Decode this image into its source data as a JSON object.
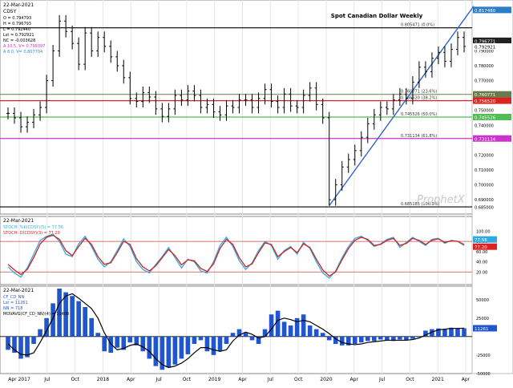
{
  "chart_data": [
    {
      "type": "bar",
      "panel": "price",
      "title": "Spot Canadian Dollar Weekly",
      "header": {
        "date": "22-Mar-2021",
        "symbol": "CDSY",
        "ohlc": [
          "O = 0.794793",
          "H = 0.796793",
          "L = 0.792440",
          "Lst = 0.792921",
          "NC = -0.003628",
          "A 10.5, V= 0.799397",
          "A 8.0, V= 0.807704"
        ]
      },
      "xlabel": "",
      "ylabel": "",
      "x_ticks": [
        "Apr 2017",
        "Jul",
        "Oct",
        "2018",
        "Apr",
        "Jul",
        "Oct",
        "2019",
        "Apr",
        "Jul",
        "Oct",
        "2020",
        "Apr",
        "Jul",
        "Oct",
        "2021",
        "Apr"
      ],
      "y_ticks": [
        "0.817480",
        "0.796771",
        "0.792921",
        "0.790000",
        "0.780000",
        "0.770000",
        "0.760771",
        "0.756520",
        "0.750000",
        "0.745526",
        "0.740000",
        "0.731134",
        "0.720000",
        "0.710000",
        "0.700000",
        "0.690000",
        "0.685000"
      ],
      "ylim": [
        0.682,
        0.822
      ],
      "price_series": [
        0.748,
        0.745,
        0.739,
        0.742,
        0.747,
        0.752,
        0.77,
        0.79,
        0.81,
        0.803,
        0.795,
        0.781,
        0.802,
        0.79,
        0.799,
        0.793,
        0.786,
        0.78,
        0.772,
        0.758,
        0.756,
        0.762,
        0.759,
        0.751,
        0.746,
        0.751,
        0.76,
        0.757,
        0.763,
        0.76,
        0.752,
        0.754,
        0.749,
        0.747,
        0.753,
        0.752,
        0.757,
        0.757,
        0.752,
        0.758,
        0.764,
        0.756,
        0.752,
        0.761,
        0.753,
        0.752,
        0.76,
        0.765,
        0.754,
        0.745,
        0.69,
        0.7,
        0.712,
        0.717,
        0.723,
        0.732,
        0.741,
        0.747,
        0.752,
        0.751,
        0.757,
        0.761,
        0.758,
        0.769,
        0.779,
        0.776,
        0.785,
        0.789,
        0.783,
        0.791,
        0.799,
        0.793
      ],
      "horizontal_levels": [
        {
          "value": 0.805471,
          "label": "0.805471 (0.0%)",
          "color": "#000000"
        },
        {
          "value": 0.760771,
          "label": "0.760771 (23.6%)",
          "color": "#7a8b5a"
        },
        {
          "value": 0.75652,
          "label": "0.756520 (38.2%)",
          "color": "#dd2222"
        },
        {
          "value": 0.745526,
          "label": "0.745526 (50.0%)",
          "color": "#55bb55"
        },
        {
          "value": 0.731134,
          "label": "0.731134 (61.8%)",
          "color": "#cc33cc"
        },
        {
          "value": 0.685185,
          "label": "0.685185 (100.0%)",
          "color": "#000000"
        }
      ],
      "trendline": {
        "from": [
          50,
          0.686
        ],
        "to": [
          71,
          0.82
        ],
        "color": "#3366cc"
      },
      "right_labels": [
        {
          "value": 0.81748,
          "text": "0.817480",
          "bg": "#2a7dc9",
          "fg": "#ffffff"
        },
        {
          "value": 0.796771,
          "text": "0.796771",
          "bg": "#222222",
          "fg": "#ffffff"
        },
        {
          "value": 0.792921,
          "text": "0.792921",
          "bg": "#ffffff",
          "fg": "#000000"
        },
        {
          "value": 0.760771,
          "text": "0.760771",
          "bg": "#6a7b4a",
          "fg": "#ffffff"
        },
        {
          "value": 0.75652,
          "text": "0.756520",
          "bg": "#dd2222",
          "fg": "#ffffff"
        },
        {
          "value": 0.745526,
          "text": "0.745526",
          "bg": "#55bb55",
          "fg": "#ffffff"
        },
        {
          "value": 0.731134,
          "text": "0.731134",
          "bg": "#cc33cc",
          "fg": "#ffffff"
        }
      ],
      "watermark": "ProphetX"
    },
    {
      "type": "line",
      "panel": "stochastic",
      "header": {
        "date": "22-Mar-2021",
        "lines": [
          "STOCH: %K(CDSY)(5) = 77.56",
          "STOCH: D(CDSY)(3) = 77.20"
        ]
      },
      "ylim": [
        0,
        110
      ],
      "levels": [
        {
          "value": 80,
          "color": "#cc4444"
        },
        {
          "value": 20,
          "color": "#cc4444"
        }
      ],
      "y_ticks": [
        "100.00",
        "80.00",
        "60.00",
        "40.00",
        "20.00"
      ],
      "series": [
        {
          "name": "STOCH: %K(CDSY)(5)",
          "color": "#33aadd",
          "values": [
            30,
            18,
            10,
            28,
            55,
            82,
            90,
            94,
            80,
            55,
            50,
            75,
            90,
            70,
            45,
            30,
            40,
            62,
            85,
            70,
            40,
            25,
            18,
            35,
            50,
            68,
            48,
            28,
            45,
            40,
            22,
            18,
            40,
            72,
            88,
            70,
            42,
            25,
            38,
            62,
            80,
            72,
            45,
            62,
            70,
            55,
            78,
            66,
            40,
            18,
            8,
            22,
            48,
            70,
            86,
            90,
            82,
            70,
            75,
            84,
            88,
            68,
            78,
            88,
            80,
            72,
            84,
            86,
            76,
            82,
            80,
            72
          ]
        },
        {
          "name": "STOCH: D(CDSY)(3)",
          "color": "#cc2222",
          "values": [
            35,
            24,
            15,
            25,
            48,
            75,
            88,
            92,
            84,
            62,
            52,
            70,
            86,
            74,
            50,
            35,
            38,
            58,
            80,
            74,
            46,
            30,
            22,
            32,
            48,
            64,
            52,
            34,
            44,
            42,
            27,
            21,
            36,
            66,
            84,
            74,
            48,
            30,
            36,
            58,
            77,
            74,
            50,
            60,
            68,
            58,
            75,
            68,
            45,
            24,
            12,
            20,
            44,
            66,
            82,
            88,
            84,
            72,
            74,
            82,
            86,
            72,
            76,
            86,
            82,
            74,
            82,
            85,
            78,
            81,
            80,
            74
          ]
        }
      ],
      "right_labels": [
        {
          "text": "77.56",
          "bg": "#33aadd",
          "fg": "#ffffff"
        },
        {
          "text": "77.20",
          "bg": "#dd2222",
          "fg": "#ffffff"
        }
      ]
    },
    {
      "type": "bar",
      "panel": "cot",
      "header": {
        "date": "22-Mar-2021",
        "lines": [
          "CF_CD_NN",
          "Lst = 11261",
          "NN = 718",
          "MOVAVG(CF_CD_NN)(4) = 11408"
        ]
      },
      "ylim": [
        -48000,
        65000
      ],
      "y_ticks": [
        "50000",
        "25000",
        "-25000",
        "-50000"
      ],
      "values": [
        -18000,
        -22000,
        -30000,
        -28000,
        -10000,
        10000,
        25000,
        45000,
        65000,
        60000,
        55000,
        48000,
        40000,
        25000,
        5000,
        -20000,
        -22000,
        -15000,
        -18000,
        -8000,
        -12000,
        -20000,
        -30000,
        -40000,
        -45000,
        -42000,
        -38000,
        -30000,
        -24000,
        -10000,
        -5000,
        -20000,
        -25000,
        -20000,
        -10000,
        5000,
        10000,
        5000,
        -5000,
        -10000,
        10000,
        30000,
        35000,
        20000,
        15000,
        25000,
        30000,
        15000,
        10000,
        5000,
        -5000,
        -10000,
        -12000,
        -12000,
        -10000,
        -8000,
        -6000,
        -6000,
        -4000,
        -5000,
        -6000,
        -4000,
        -5000,
        -3000,
        -1000,
        8000,
        10000,
        11000,
        10000,
        12000,
        11000,
        11261
      ],
      "series": [
        {
          "name": "CF_CD_NN",
          "color": "#2255cc"
        },
        {
          "name": "MOVAVG(CF_CD_NN)(4)",
          "color": "#000000",
          "values": [
            -10000,
            -18000,
            -24000,
            -25000,
            -22000,
            -8000,
            8000,
            25000,
            45000,
            55000,
            58000,
            52000,
            45000,
            38000,
            25000,
            5000,
            -10000,
            -18000,
            -16000,
            -12000,
            -10000,
            -14000,
            -20000,
            -30000,
            -38000,
            -42000,
            -40000,
            -36000,
            -30000,
            -22000,
            -15000,
            -15000,
            -18000,
            -20000,
            -18000,
            -6000,
            2000,
            6000,
            3000,
            -2000,
            0,
            10000,
            22000,
            25000,
            23000,
            20000,
            22000,
            20000,
            15000,
            10000,
            4000,
            -3000,
            -8000,
            -10000,
            -11000,
            -10000,
            -8000,
            -7000,
            -6000,
            -5000,
            -5000,
            -5000,
            -5000,
            -4000,
            -2000,
            2000,
            6000,
            9000,
            10000,
            11000,
            11000,
            11408
          ]
        }
      ],
      "right_labels": [
        {
          "text": "11261",
          "bg": "#2255cc",
          "fg": "#ffffff"
        }
      ]
    }
  ]
}
